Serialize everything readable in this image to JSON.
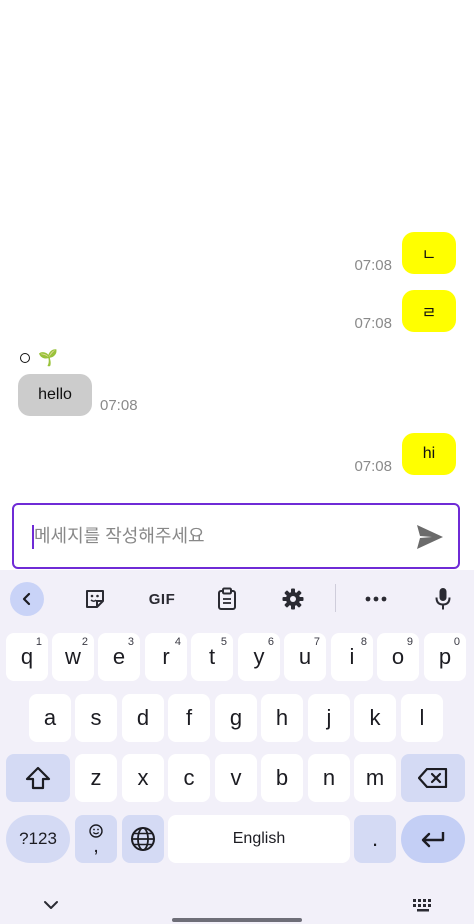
{
  "messages": {
    "out1": {
      "text": "ㄴ",
      "time": "07:08"
    },
    "out2": {
      "text": "ㄹ",
      "time": "07:08"
    },
    "sender": {
      "name": "🌱"
    },
    "in1": {
      "text": "hello",
      "time": "07:08"
    },
    "out3": {
      "text": "hi",
      "time": "07:08"
    }
  },
  "composer": {
    "placeholder": "메세지를 작성해주세요"
  },
  "keyboard": {
    "toolbar": {
      "gif_label": "GIF"
    },
    "row1": [
      {
        "label": "q",
        "hint": "1"
      },
      {
        "label": "w",
        "hint": "2"
      },
      {
        "label": "e",
        "hint": "3"
      },
      {
        "label": "r",
        "hint": "4"
      },
      {
        "label": "t",
        "hint": "5"
      },
      {
        "label": "y",
        "hint": "6"
      },
      {
        "label": "u",
        "hint": "7"
      },
      {
        "label": "i",
        "hint": "8"
      },
      {
        "label": "o",
        "hint": "9"
      },
      {
        "label": "p",
        "hint": "0"
      }
    ],
    "row2": [
      "a",
      "s",
      "d",
      "f",
      "g",
      "h",
      "j",
      "k",
      "l"
    ],
    "row3": [
      "z",
      "x",
      "c",
      "v",
      "b",
      "n",
      "m"
    ],
    "num_label": "?123",
    "comma_label": ",",
    "space_label": "English",
    "period_label": "."
  },
  "colors": {
    "outgoing_bubble": "#ffff00",
    "incoming_bubble": "#cccccc",
    "accent": "#6f2bd6",
    "keyboard_bg": "#f2f0f9",
    "modifier_key": "#d4daf4"
  }
}
